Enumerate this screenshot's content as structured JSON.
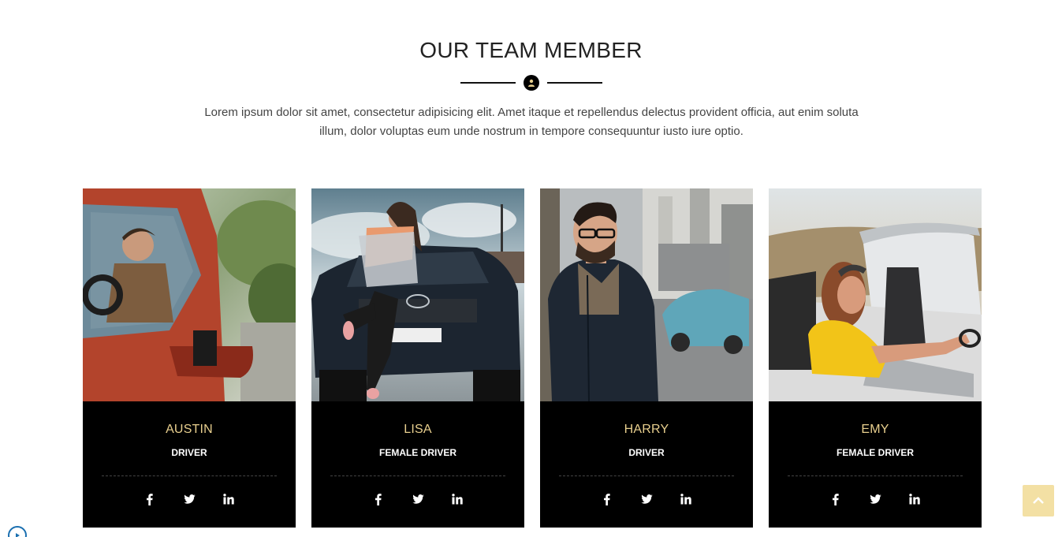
{
  "section": {
    "title": "OUR TEAM MEMBER",
    "divider_icon": "user-icon",
    "intro": "Lorem ipsum dolor sit amet, consectetur adipisicing elit. Amet itaque et repellendus delectus provident officia, aut enim soluta illum, dolor voluptas eum unde nostrum in tempore consequuntur iusto iure optio."
  },
  "team": [
    {
      "name": "AUSTIN",
      "role": "DRIVER"
    },
    {
      "name": "LISA",
      "role": "FEMALE DRIVER"
    },
    {
      "name": "HARRY",
      "role": "DRIVER"
    },
    {
      "name": "EMY",
      "role": "FEMALE DRIVER"
    }
  ],
  "social_icons": [
    "facebook-icon",
    "twitter-icon",
    "linkedin-icon"
  ],
  "colors": {
    "accent": "#e8cf8e",
    "card_bg": "#000000",
    "scroll_top_bg": "#f3e0a4"
  },
  "scroll_top_icon": "chevron-up-icon"
}
